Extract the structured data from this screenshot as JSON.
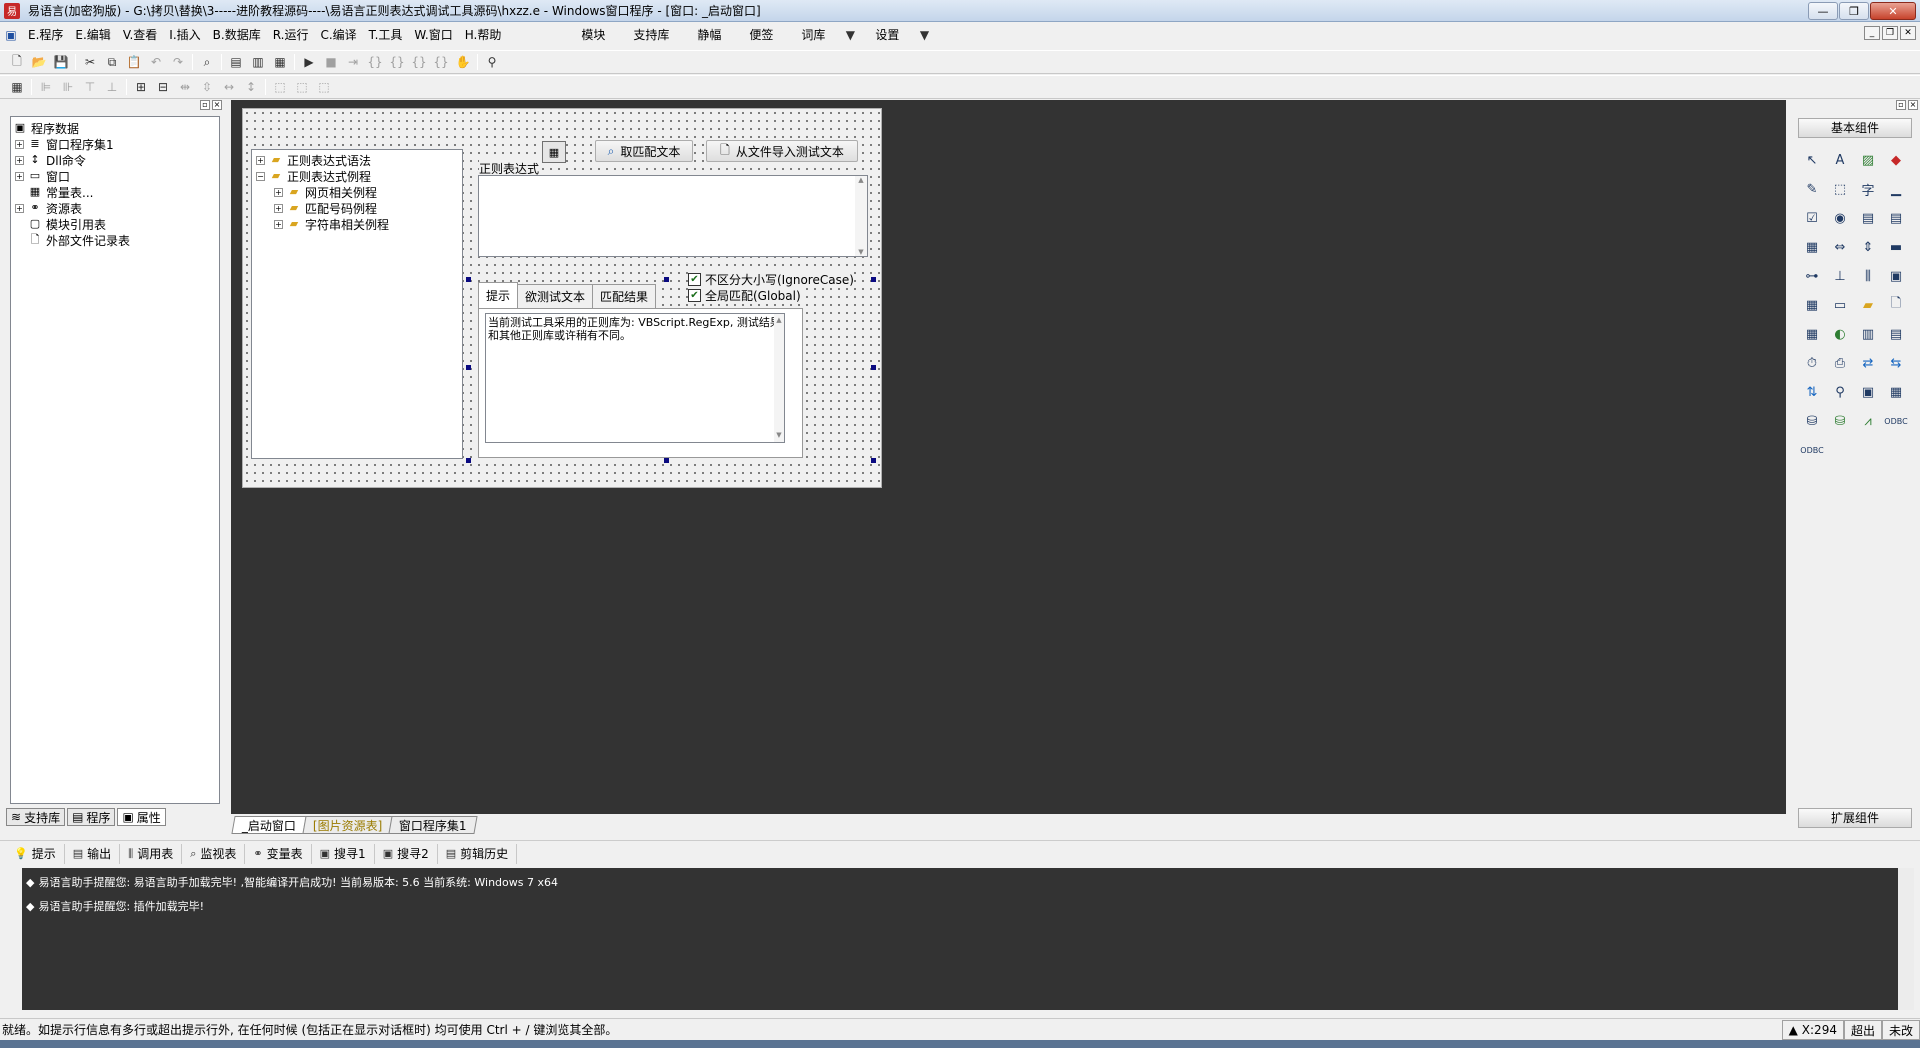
{
  "window": {
    "title": "易语言(加密狗版) - G:\\拷贝\\替换\\3-----进阶教程源码----\\易语言正则表达式调试工具源码\\hxzz.e - Windows窗口程序 - [窗口: _启动窗口]"
  },
  "menu": {
    "items": [
      "E.程序",
      "E.编辑",
      "V.查看",
      "I.插入",
      "B.数据库",
      "R.运行",
      "C.编译",
      "T.工具",
      "W.窗口",
      "H.帮助"
    ],
    "right_items": [
      "模块",
      "支持库",
      "静幅",
      "便签",
      "词库",
      "设置"
    ]
  },
  "left_panel": {
    "tree": {
      "root": "程序数据",
      "items": [
        "窗口程序集1",
        "Dll命令",
        "窗口",
        "常量表...",
        "资源表",
        "模块引用表",
        "外部文件记录表"
      ]
    },
    "tabs": [
      "支持库",
      "程序",
      "属性"
    ]
  },
  "form": {
    "tree": {
      "items": [
        "正则表达式语法",
        "正则表达式例程",
        "网页相关例程",
        "匹配号码例程",
        "字符串相关例程"
      ]
    },
    "regex_label": "正则表达式",
    "btn_get_match": "取匹配文本",
    "btn_import_file": "从文件导入测试文本",
    "chk_ignorecase": "不区分大小写(IgnoreCase)",
    "chk_global": "全局匹配(Global)",
    "tabs": [
      "提示",
      "欲测试文本",
      "匹配结果"
    ],
    "hint_text": "当前测试工具采用的正则库为: VBScript.RegExp, 测试结果和其他正则库或许稍有不同。"
  },
  "editor_tabs": [
    "_启动窗口",
    "[图片资源表]",
    "窗口程序集1"
  ],
  "palette": {
    "header": "基本组件",
    "footer": "扩展组件"
  },
  "output_tabs": [
    "提示",
    "输出",
    "调用表",
    "监视表",
    "变量表",
    "搜寻1",
    "搜寻2",
    "剪辑历史"
  ],
  "output_lines": [
    "易语言助手提醒您: 易语言助手加载完毕! ,智能编译开启成功! 当前易版本: 5.6 当前系统: Windows 7 x64",
    "易语言助手提醒您: 插件加载完毕!"
  ],
  "status": {
    "text": "就绪。如提示行信息有多行或超出提示行外, 在任何时候 (包括正在显示对话框时) 均可使用 Ctrl + / 键浏览其全部。",
    "coord": "X:294",
    "mode1": "超出",
    "mode2": "未改"
  }
}
